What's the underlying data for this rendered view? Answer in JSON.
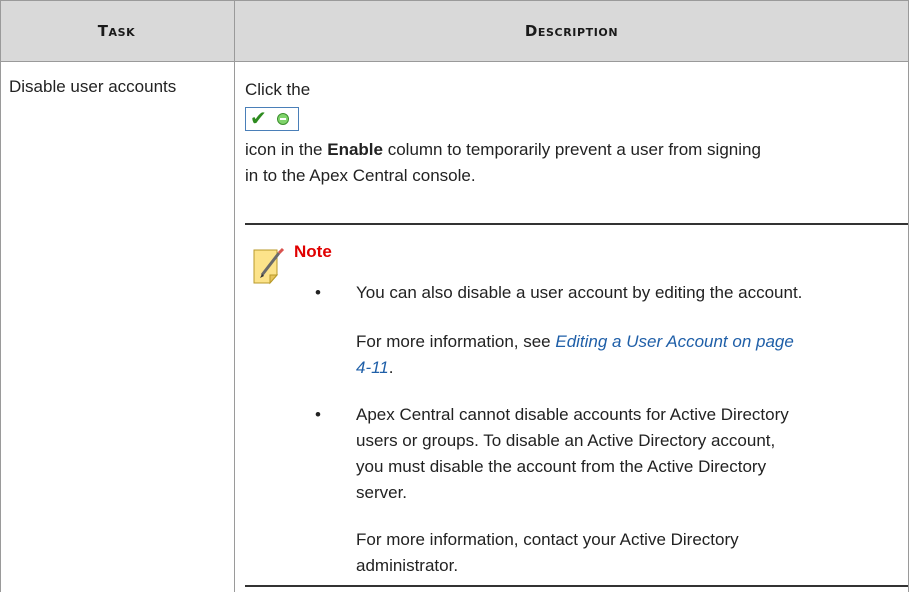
{
  "table": {
    "headers": {
      "task": "Task",
      "description": "Description"
    },
    "row": {
      "task": "Disable user accounts",
      "description": {
        "line1": "Click the",
        "icon": "enable-check-icon",
        "line2_pre": "icon in the ",
        "line2_bold": "Enable",
        "line2_post": " column to temporarily prevent a user from signing",
        "line3": "in to the Apex Central console."
      }
    }
  },
  "note": {
    "title": "Note",
    "bullets": [
      {
        "text": "You can also disable a user account by editing the account.",
        "more_pre": "For more information, see ",
        "link_line1": "Editing a User Account on page",
        "link_line2": "4-11",
        "more_post": "."
      },
      {
        "lines": [
          "Apex Central cannot disable accounts for Active Directory",
          "users or groups. To disable an Active Directory account,",
          "you must disable the account from the Active Directory",
          "server."
        ],
        "more_lines": [
          "For more information, contact your Active Directory",
          "administrator."
        ]
      }
    ]
  },
  "colors": {
    "header_bg": "#d9d9d9",
    "note_title": "#e00000",
    "link": "#1f5fa8",
    "check": "#2e8b1f"
  }
}
